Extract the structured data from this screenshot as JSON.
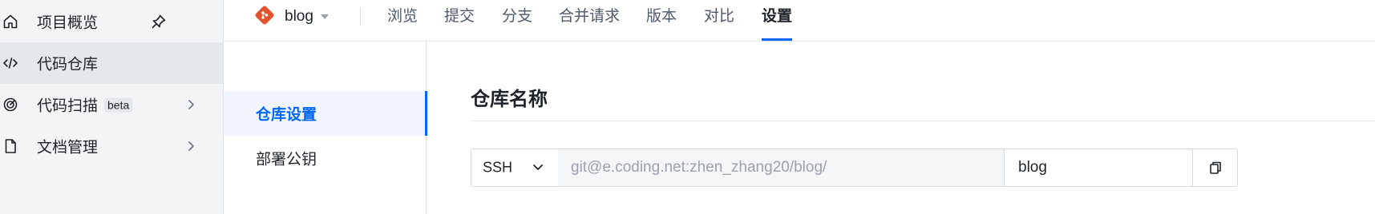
{
  "sidebar": {
    "items": [
      {
        "label": "项目概览",
        "icon": "home-icon"
      },
      {
        "label": "代码仓库",
        "icon": "code-icon"
      },
      {
        "label": "代码扫描",
        "icon": "scan-icon",
        "badge": "beta"
      },
      {
        "label": "文档管理",
        "icon": "document-icon"
      }
    ]
  },
  "repo": {
    "name": "blog",
    "icon": "git-icon",
    "brand_color": "#e2532d"
  },
  "tabs": [
    "浏览",
    "提交",
    "分支",
    "合并请求",
    "版本",
    "对比",
    "设置"
  ],
  "active_tab": "设置",
  "settings_menu": {
    "items": [
      "仓库设置",
      "部署公钥"
    ],
    "active": "仓库设置"
  },
  "main": {
    "section_title": "仓库名称",
    "clone": {
      "protocol": "SSH",
      "url_prefix": "git@e.coding.net:zhen_zhang20/blog/",
      "repo_name": "blog",
      "copy_icon": "copy-icon"
    }
  },
  "colors": {
    "accent": "#0066ff",
    "sidebar_bg": "#f3f4f6",
    "active_item_bg": "#e4e7ec"
  }
}
